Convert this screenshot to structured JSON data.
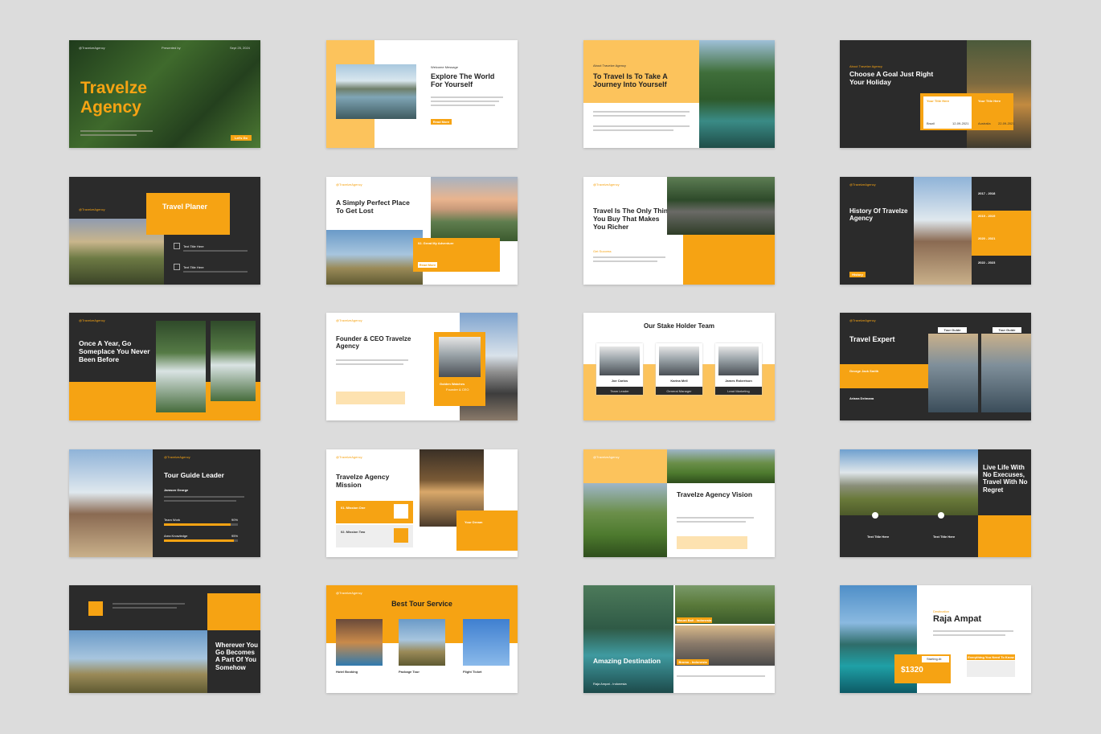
{
  "slides": {
    "s1": {
      "title": "Travelze Agency",
      "tag_left": "@TravelzeAgency",
      "tag_mid": "Presented by",
      "tag_right": "Sept 25, 2024",
      "button": "Let's Go"
    },
    "s2": {
      "kicker": "Welcome Message",
      "title": "Explore The World For Yourself",
      "button": "Read More"
    },
    "s3": {
      "kicker": "About Travelze Agency",
      "title": "To Travel Is To Take A Journey Into Yourself"
    },
    "s4": {
      "kicker": "About Travelze Agency",
      "title": "Choose A Goal Just Right Your Holiday",
      "card1_title": "Your Title Here",
      "card1_place": "Brazil",
      "card1_date": "12-09-2021",
      "card2_title": "Your Title Here",
      "card2_place": "Australia",
      "card2_date": "22-09-2021"
    },
    "s5": {
      "tag": "@TravelzeAgency",
      "title": "Travel Planer",
      "item1": "Text Title Here",
      "item2": "Text Title Here"
    },
    "s6": {
      "tag": "@TravelzeAgency",
      "title": "A Simply Perfect Place To Get Lost",
      "box_title": "02. Great My Adventure",
      "button": "Read More"
    },
    "s7": {
      "tag": "@TravelzeAgency",
      "title": "Travel Is The Only Thing You Buy That Makes You Richer",
      "kicker": "Get Success"
    },
    "s8": {
      "tag": "@TravelzeAgency",
      "title": "History Of Travelze Agency",
      "years": [
        "2017 - 2018",
        "2019 - 2019",
        "2020 - 2021",
        "2022 - 2023"
      ],
      "button": "History"
    },
    "s9": {
      "tag": "@TravelzeAgency",
      "title": "Once A Year, Go Someplace You Never Been Before"
    },
    "s10": {
      "tag": "@TravelzeAgency",
      "title": "Founder & CEO Travelze Agency",
      "name": "Golden Watches",
      "role": "Founder & CEO"
    },
    "s11": {
      "title": "Our Stake Holder Team",
      "members": [
        {
          "name": "Joe Carlos",
          "role": "Team Leader"
        },
        {
          "name": "Karina Mell",
          "role": "General Manager"
        },
        {
          "name": "James Robertson",
          "role": "Lead Marketing"
        }
      ]
    },
    "s12": {
      "tag": "@TravelzeAgency",
      "title": "Travel Expert",
      "label1": "Tour Guide",
      "label2": "Tour Guide",
      "name1": "George Jack Smith",
      "name2": "Ariana Delmana"
    },
    "s13": {
      "tag": "@TravelzeAgency",
      "title": "Tour Guide Leader",
      "name": "Jamson George",
      "skill1": "Team Work",
      "skill1_pct": 90,
      "skill1_label": "90%",
      "skill2": "Area Knowledge",
      "skill2_pct": 95,
      "skill2_label": "95%"
    },
    "s14": {
      "tag": "@TravelzeAgency",
      "title": "Travelze Agency Mission",
      "m1": "01. Mission One",
      "m2": "02. Mission Two",
      "dream": "Your Dream"
    },
    "s15": {
      "tag": "@TravelzeAgency",
      "title": "Travelze Agency Vision"
    },
    "s16": {
      "title": "Live Life With No Execuses, Travel With No Regret",
      "c1": "Text Title Here",
      "c2": "Text Title Here"
    },
    "s17": {
      "title": "Wherever You Go Becomes A Part Of You Somehow"
    },
    "s18": {
      "tag": "@TravelzeAgency",
      "title": "Best Tour Service",
      "items": [
        "Hotel Booking",
        "Package Tour",
        "Flight Ticket"
      ]
    },
    "s19": {
      "title": "Amazing Destination",
      "l1": "Raja Ampat - Indonesia",
      "l2": "Mount Bali - Indonesia",
      "l3": "Bromo - Indonesia"
    },
    "s20": {
      "tag": "Destination",
      "title": "Raja Ampat",
      "price": "$1320",
      "starting": "Starting At",
      "box": "Everything You Need To Know"
    }
  }
}
